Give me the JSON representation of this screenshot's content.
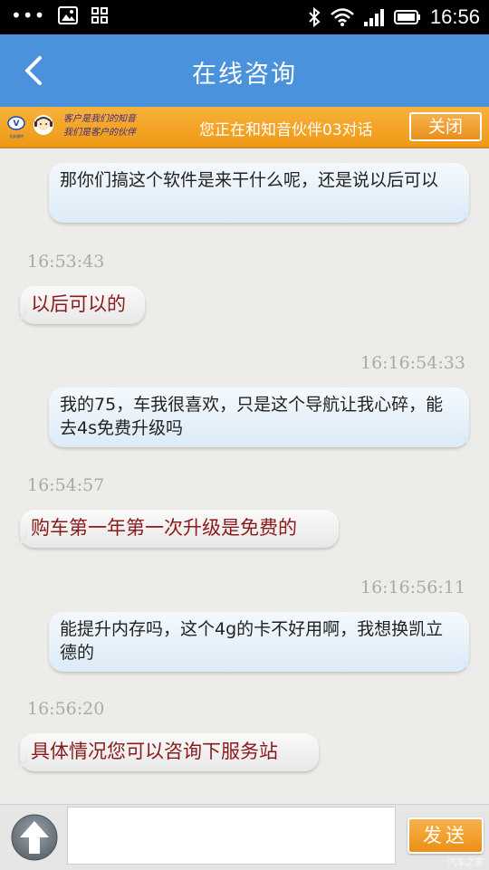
{
  "status_bar": {
    "time": "16:56",
    "dots": "•••"
  },
  "header": {
    "title": "在线咨询"
  },
  "banner": {
    "logo_text": "长安福特",
    "slogan_line1": "客户是我们的知音",
    "slogan_line2": "我们是客户的伙伴",
    "status": "您正在和知音伙伴03对话",
    "close_label": "关闭"
  },
  "messages": [
    {
      "type": "outgoing",
      "text": "那你们搞这个软件是来干什么呢，还是说以后可以"
    },
    {
      "type": "timestamp",
      "text": "16:53:43"
    },
    {
      "type": "incoming",
      "text": "以后可以的"
    },
    {
      "type": "timestamp",
      "text": "16:16:54:33"
    },
    {
      "type": "outgoing",
      "text": "我的75，车我很喜欢，只是这个导航让我心碎，能去4s免费升级吗"
    },
    {
      "type": "timestamp",
      "text": "16:54:57"
    },
    {
      "type": "incoming",
      "text": "购车第一年第一次升级是免费的"
    },
    {
      "type": "timestamp",
      "text": "16:16:56:11"
    },
    {
      "type": "outgoing",
      "text": "能提升内存吗，这个4g的卡不好用啊，我想换凯立德的"
    },
    {
      "type": "timestamp",
      "text": "16:56:20"
    },
    {
      "type": "incoming",
      "text": "具体情况您可以咨询下服务站"
    }
  ],
  "input_bar": {
    "message_value": "",
    "send_label": "发送"
  },
  "watermark": "汽车之家"
}
